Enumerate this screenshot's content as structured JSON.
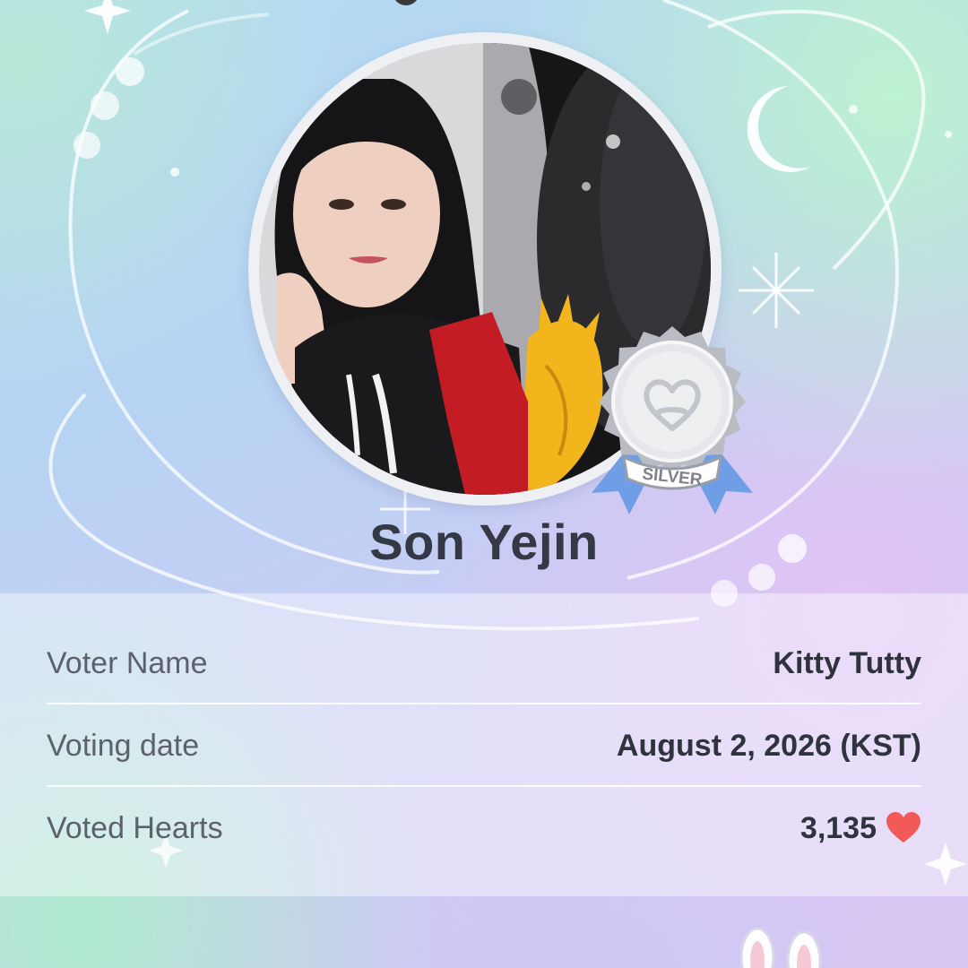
{
  "profile": {
    "name": "Son Yejin",
    "photo_icon": "portrait-photo",
    "badge": {
      "label": "SILVER",
      "icon": "heart-medal-icon",
      "color": "#c8ccd2",
      "ribbon_color": "#6f9ee6"
    }
  },
  "details": {
    "voter_name": {
      "label": "Voter Name",
      "value": "Kitty Tutty"
    },
    "voting_date": {
      "label": "Voting date",
      "value": "August 2, 2026 (KST)"
    },
    "voted_hearts": {
      "label": "Voted Hearts",
      "value": "3,135",
      "icon": "heart-icon",
      "icon_color": "#f25a5a"
    }
  }
}
